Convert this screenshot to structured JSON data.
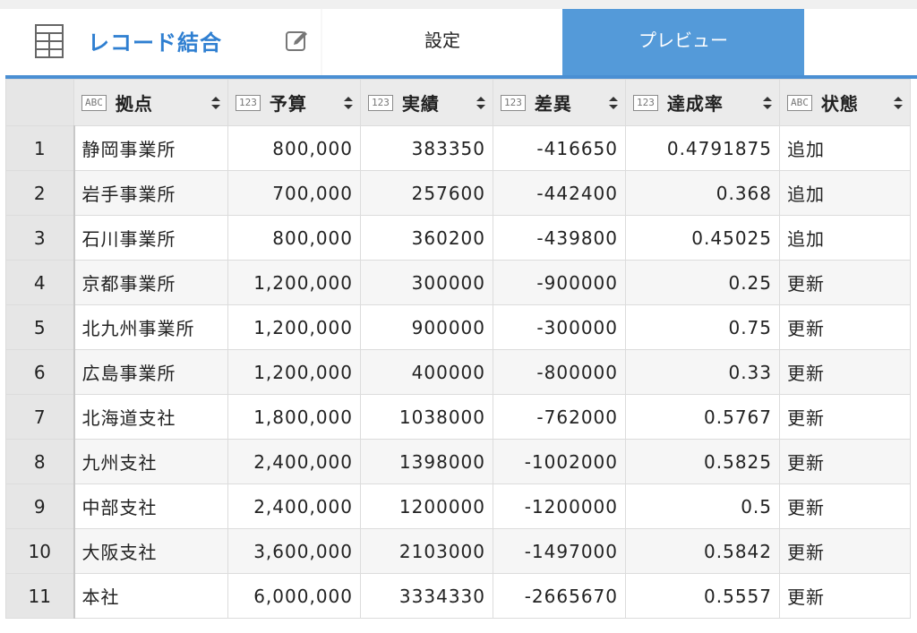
{
  "app": {
    "title": "レコード結合",
    "icon": "table-grid-icon",
    "edit_icon": "pencil-edit-icon"
  },
  "tabs": [
    {
      "label": "設定",
      "active": false
    },
    {
      "label": "プレビュー",
      "active": true
    }
  ],
  "colors": {
    "accent": "#2f7fd1",
    "active_tab": "#549ad9",
    "header_bg": "#ebebeb"
  },
  "table": {
    "columns": [
      {
        "type": "ABC",
        "label": "拠点"
      },
      {
        "type": "123",
        "label": "予算"
      },
      {
        "type": "123",
        "label": "実績"
      },
      {
        "type": "123",
        "label": "差異"
      },
      {
        "type": "123",
        "label": "達成率"
      },
      {
        "type": "ABC",
        "label": "状態"
      }
    ],
    "rows": [
      [
        "1",
        "静岡事業所",
        "800,000",
        "383350",
        "-416650",
        "0.4791875",
        "追加"
      ],
      [
        "2",
        "岩手事業所",
        "700,000",
        "257600",
        "-442400",
        "0.368",
        "追加"
      ],
      [
        "3",
        "石川事業所",
        "800,000",
        "360200",
        "-439800",
        "0.45025",
        "追加"
      ],
      [
        "4",
        "京都事業所",
        "1,200,000",
        "300000",
        "-900000",
        "0.25",
        "更新"
      ],
      [
        "5",
        "北九州事業所",
        "1,200,000",
        "900000",
        "-300000",
        "0.75",
        "更新"
      ],
      [
        "6",
        "広島事業所",
        "1,200,000",
        "400000",
        "-800000",
        "0.33",
        "更新"
      ],
      [
        "7",
        "北海道支社",
        "1,800,000",
        "1038000",
        "-762000",
        "0.5767",
        "更新"
      ],
      [
        "8",
        "九州支社",
        "2,400,000",
        "1398000",
        "-1002000",
        "0.5825",
        "更新"
      ],
      [
        "9",
        "中部支社",
        "2,400,000",
        "1200000",
        "-1200000",
        "0.5",
        "更新"
      ],
      [
        "10",
        "大阪支社",
        "3,600,000",
        "2103000",
        "-1497000",
        "0.5842",
        "更新"
      ],
      [
        "11",
        "本社",
        "6,000,000",
        "3334330",
        "-2665670",
        "0.5557",
        "更新"
      ]
    ]
  }
}
